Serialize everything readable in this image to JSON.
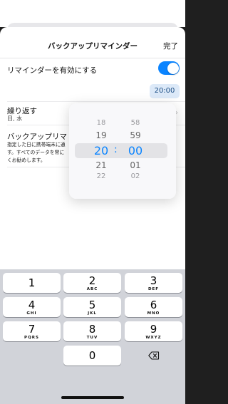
{
  "nav": {
    "title": "バックアップリマインダー",
    "done": "完了"
  },
  "settings": {
    "enable_label": "リマインダーを有効にする",
    "enable_on": true,
    "time_value": "20:00",
    "repeat_label": "繰り返す",
    "repeat_value": "日, 水",
    "backup_label": "バックアップリマ",
    "backup_desc_1": "指定した日に携帯端末に通",
    "backup_desc_2": "す。すべてのデータを常に",
    "backup_desc_3": "くお勧めします。"
  },
  "picker": {
    "hours": [
      "18",
      "19",
      "20",
      "21",
      "22"
    ],
    "minutes": [
      "58",
      "59",
      "00",
      "01",
      "02"
    ],
    "separator": ":"
  },
  "keyboard": {
    "keys": [
      {
        "num": "1",
        "sub": ""
      },
      {
        "num": "2",
        "sub": "ABC"
      },
      {
        "num": "3",
        "sub": "DEF"
      },
      {
        "num": "4",
        "sub": "GHI"
      },
      {
        "num": "5",
        "sub": "JKL"
      },
      {
        "num": "6",
        "sub": "MNO"
      },
      {
        "num": "7",
        "sub": "PQRS"
      },
      {
        "num": "8",
        "sub": "TUV"
      },
      {
        "num": "9",
        "sub": "WXYZ"
      },
      {
        "num": "0",
        "sub": ""
      }
    ],
    "backspace_icon": "delete-left-icon"
  },
  "colors": {
    "accent": "#0a84ff",
    "keyboard_bg": "#d1d3d9"
  }
}
